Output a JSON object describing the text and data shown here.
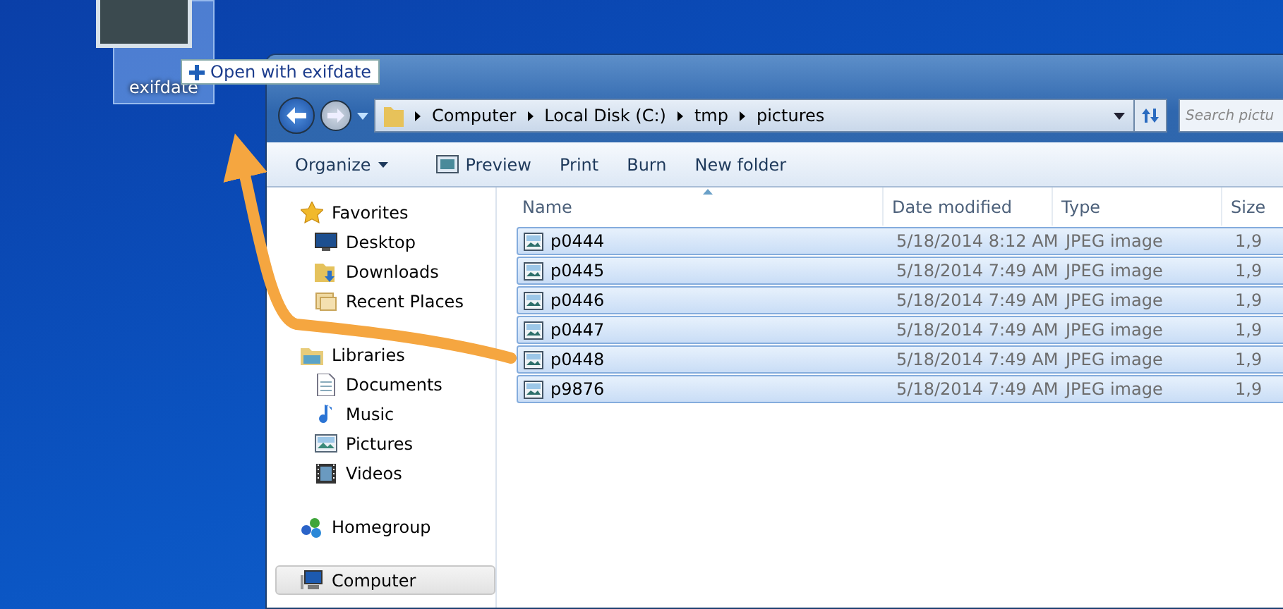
{
  "desktop_icon": {
    "label": "exifdate",
    "selected": true
  },
  "drag_tooltip": {
    "text": "Open with exifdate"
  },
  "address_bar": {
    "breadcrumbs": [
      "Computer",
      "Local Disk (C:)",
      "tmp",
      "pictures"
    ]
  },
  "search": {
    "placeholder": "Search pictu"
  },
  "toolbar": {
    "buttons": [
      {
        "label": "Organize",
        "kind": "menu"
      },
      {
        "label": "Preview",
        "kind": "icon"
      },
      {
        "label": "Print",
        "kind": "plain"
      },
      {
        "label": "Burn",
        "kind": "plain"
      },
      {
        "label": "New folder",
        "kind": "plain"
      }
    ]
  },
  "nav_pane": {
    "items": [
      {
        "label": "Favorites",
        "selected": false,
        "children": [
          {
            "label": "Desktop",
            "selected": false
          },
          {
            "label": "Downloads",
            "selected": false
          },
          {
            "label": "Recent Places",
            "selected": false
          }
        ]
      },
      {
        "label": "Libraries",
        "selected": false,
        "children": [
          {
            "label": "Documents",
            "selected": false
          },
          {
            "label": "Music",
            "selected": false
          },
          {
            "label": "Pictures",
            "selected": false
          },
          {
            "label": "Videos",
            "selected": false
          }
        ]
      },
      {
        "label": "Homegroup",
        "selected": false
      },
      {
        "label": "Computer",
        "selected": true
      }
    ]
  },
  "table": {
    "columns": [
      "Name",
      "Date modified",
      "Type",
      "Size"
    ],
    "rows": [
      {
        "name": "p0444",
        "date": "5/18/2014 8:12 AM",
        "type": "JPEG image",
        "size": "1,9",
        "selected": true
      },
      {
        "name": "p0445",
        "date": "5/18/2014 7:49 AM",
        "type": "JPEG image",
        "size": "1,9",
        "selected": true
      },
      {
        "name": "p0446",
        "date": "5/18/2014 7:49 AM",
        "type": "JPEG image",
        "size": "1,9",
        "selected": true
      },
      {
        "name": "p0447",
        "date": "5/18/2014 7:49 AM",
        "type": "JPEG image",
        "size": "1,9",
        "selected": true
      },
      {
        "name": "p0448",
        "date": "5/18/2014 7:49 AM",
        "type": "JPEG image",
        "size": "1,9",
        "selected": true
      },
      {
        "name": "p9876",
        "date": "5/18/2014 7:49 AM",
        "type": "JPEG image",
        "size": "1,9",
        "selected": true
      }
    ]
  }
}
